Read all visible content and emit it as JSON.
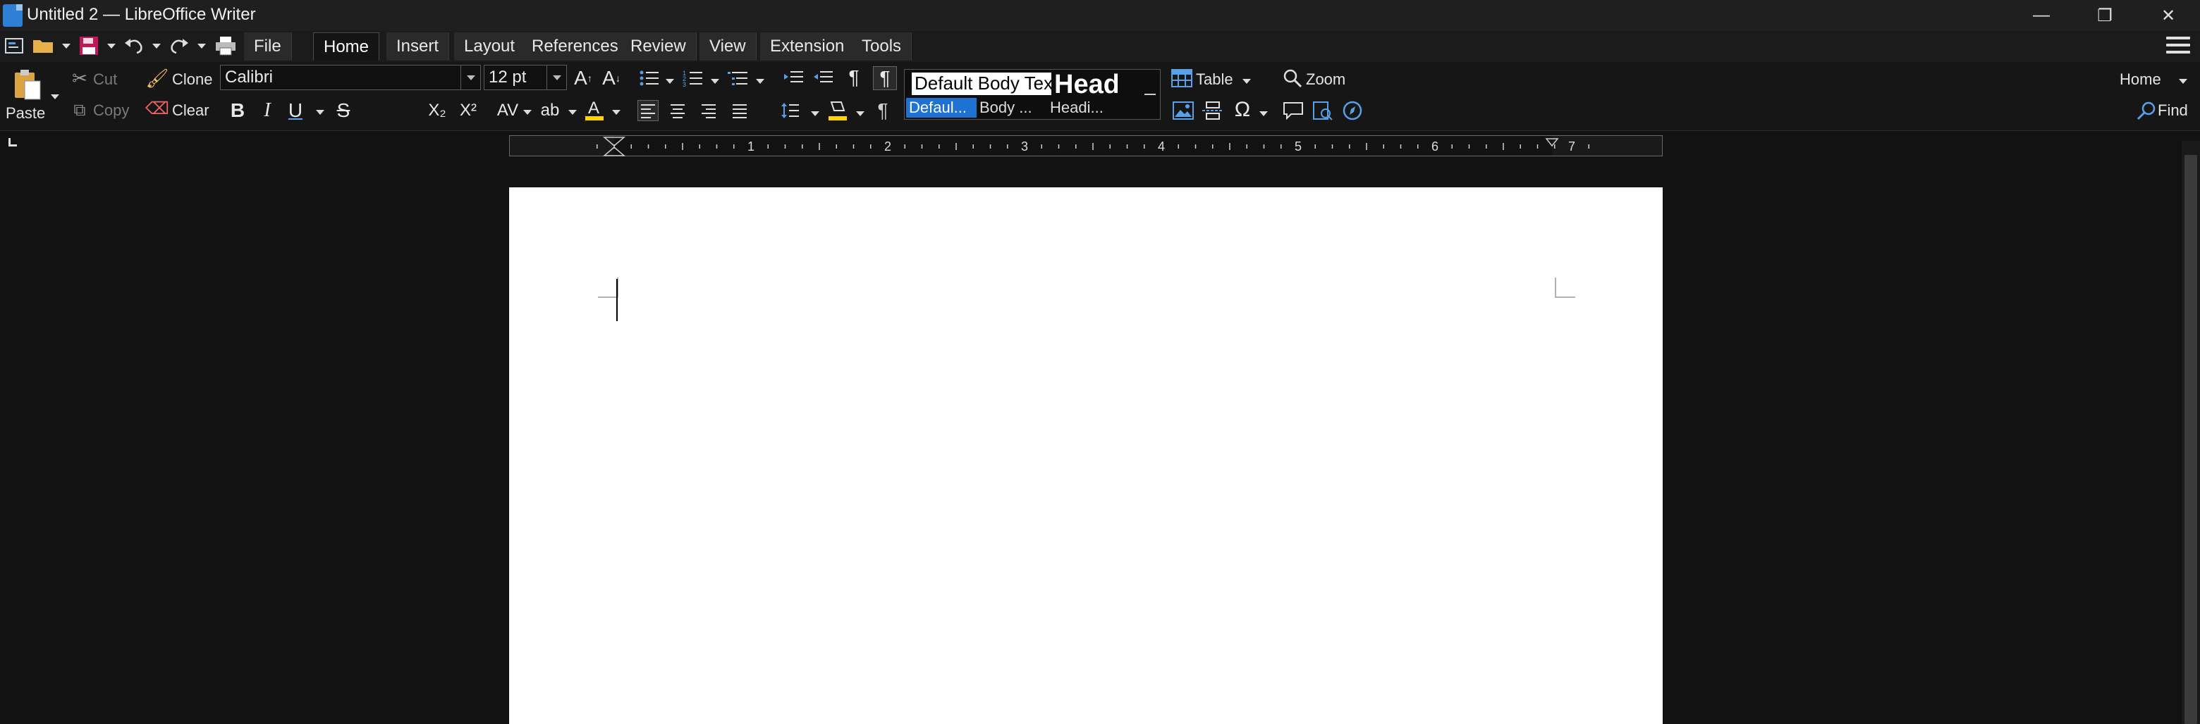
{
  "window": {
    "title": "Untitled 2 — LibreOffice Writer",
    "minimize": "—",
    "restore": "❐",
    "close": "✕"
  },
  "menu": {
    "tabs": [
      "File",
      "Home",
      "Insert",
      "Layout",
      "References",
      "Review",
      "View",
      "Extension",
      "Tools"
    ],
    "active_tab": "Home"
  },
  "ribbon": {
    "clipboard": {
      "paste": "Paste",
      "cut": "Cut",
      "copy": "Copy",
      "clone": "Clone",
      "clear": "Clear"
    },
    "font_name": "Calibri",
    "font_size": "12 pt",
    "format": {
      "bold": "B",
      "italic": "I",
      "underline": "U",
      "strike": "S",
      "subscript": "X₂",
      "superscript": "X²"
    },
    "styles": {
      "preview_default": "Default Body Text",
      "preview_heading": "Heading",
      "list": [
        "Defaul...",
        "Body ...",
        "Headi..."
      ],
      "selected": "Defaul..."
    },
    "table": "Table",
    "zoom": "Zoom",
    "home_dropdown": "Home",
    "find": "Find"
  },
  "ruler": {
    "numbers": [
      "1",
      "2",
      "3",
      "4",
      "5",
      "6",
      "7"
    ]
  },
  "colors": {
    "accent": "#1e73d2",
    "background": "#121212",
    "page": "#ffffff",
    "highlight": "#ffd400",
    "font_color": "#e6e6e6"
  }
}
